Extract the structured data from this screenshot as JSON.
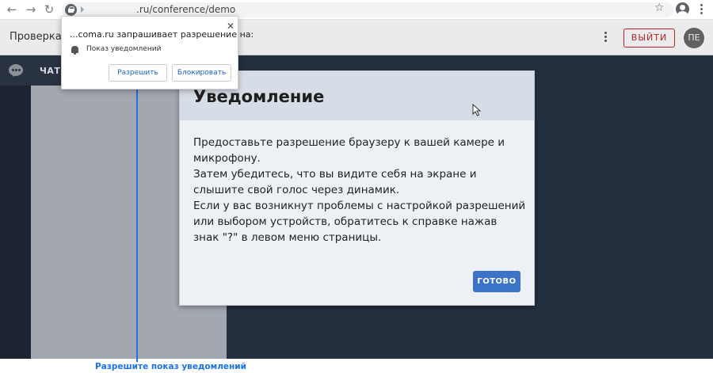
{
  "browser": {
    "back_glyph": "←",
    "forward_glyph": "→",
    "reload_glyph": "↻",
    "url": ".ru/conference/demo",
    "star_glyph": "☆"
  },
  "header": {
    "title": "Проверка у",
    "exit_label": "ВЫЙТИ",
    "avatar_initials": "ПЕ"
  },
  "sidebar": {
    "chat_label": "ЧАТЫ"
  },
  "modal": {
    "title": "Уведомление",
    "body": [
      "Предоставьте разрешение браузеру к вашей камере и микрофону.",
      "Затем убедитесь, что вы видите себя на экране и слышите свой голос через динамик.",
      "Если у вас возникнут проблемы с настройкой разрешений или выбором устройств, обратитесь к справке нажав знак \"?\" в левом меню страницы."
    ],
    "done_label": "ГОТОВО"
  },
  "permission_popup": {
    "title": "...coma.ru запрашивает разрешение на:",
    "close_glyph": "✕",
    "notice": "Показ уведомлений",
    "allow_label": "Разрешить",
    "block_label": "Блокировать"
  },
  "annotation": {
    "label": "Разрешите показ уведомлений"
  },
  "colors": {
    "accent": "#3b73c8",
    "exit_red": "#c62828",
    "annotation_blue": "#1a73e8"
  }
}
